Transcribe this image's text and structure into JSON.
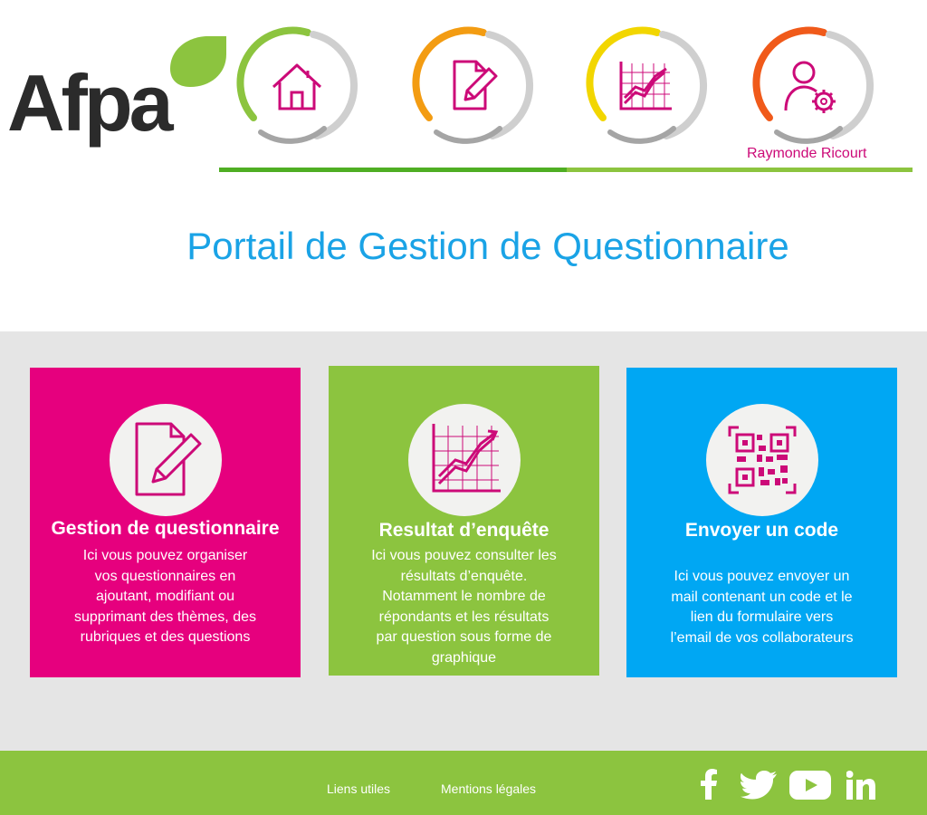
{
  "brand": {
    "logo_text": "Afpa"
  },
  "nav": {
    "items": [
      {
        "icon": "home-icon",
        "ring_color": "#8cc43f"
      },
      {
        "icon": "edit-document-icon",
        "ring_color": "#f39c12"
      },
      {
        "icon": "chart-icon",
        "ring_color": "#f2d600"
      },
      {
        "icon": "user-settings-icon",
        "ring_color": "#f05a1a"
      }
    ],
    "user_name": "Raymonde Ricourt"
  },
  "page": {
    "title": "Portail de Gestion de Questionnaire"
  },
  "cards": [
    {
      "title": "Gestion de questionnaire",
      "color": "#e6007e",
      "icon": "edit-document-icon",
      "desc": [
        "Ici vous pouvez organiser",
        "vos questionnaires en",
        "ajoutant, modifiant ou",
        "supprimant des thèmes, des",
        "rubriques et des questions"
      ]
    },
    {
      "title": "Resultat d’enquête",
      "color": "#8cc43f",
      "icon": "chart-icon",
      "desc": [
        "Ici vous pouvez consulter les",
        "résultats d’enquête.",
        "Notamment le nombre de",
        "répondants et les résultats",
        "par question sous forme de",
        "graphique"
      ]
    },
    {
      "title": "Envoyer un code",
      "color": "#00a7f3",
      "icon": "qr-code-icon",
      "desc": [
        "Ici vous pouvez envoyer un",
        "mail contenant un code et le",
        "lien du formulaire vers",
        "l’email de vos collaborateurs"
      ]
    }
  ],
  "footer": {
    "links": [
      "Liens utiles",
      "Mentions légales"
    ],
    "social": [
      "facebook-icon",
      "twitter-icon",
      "youtube-icon",
      "linkedin-icon"
    ]
  },
  "colors": {
    "accent_blue": "#1aa3e6",
    "magenta": "#e6007e",
    "green": "#8cc43f",
    "dark_green": "#4fae23"
  }
}
